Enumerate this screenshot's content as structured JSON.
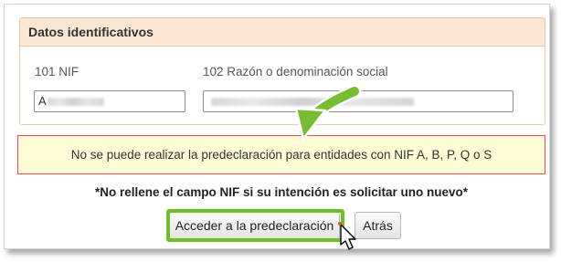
{
  "panel": {
    "title": "Datos identificativos",
    "nif_label": "101 NIF",
    "nif_value": "A",
    "razon_label": "102 Razón o denominación social",
    "razon_value": ""
  },
  "alert": {
    "message": "No se puede realizar la predeclaración para entidades con NIF A, B, P, Q o S"
  },
  "note": "*No rellene el campo NIF si su intención es solicitar uno nuevo*",
  "buttons": {
    "primary_label": "Acceder a la predeclaración",
    "back_label": "Atrás"
  },
  "colors": {
    "highlight": "#6fbf2a",
    "arrow": "#77bd33",
    "alert_border": "#e05050",
    "alert_bg": "#fdfbd6",
    "header_bg": "#fbe6d3"
  },
  "icons": [
    "green-arrow-icon",
    "pointer-cursor-icon"
  ]
}
